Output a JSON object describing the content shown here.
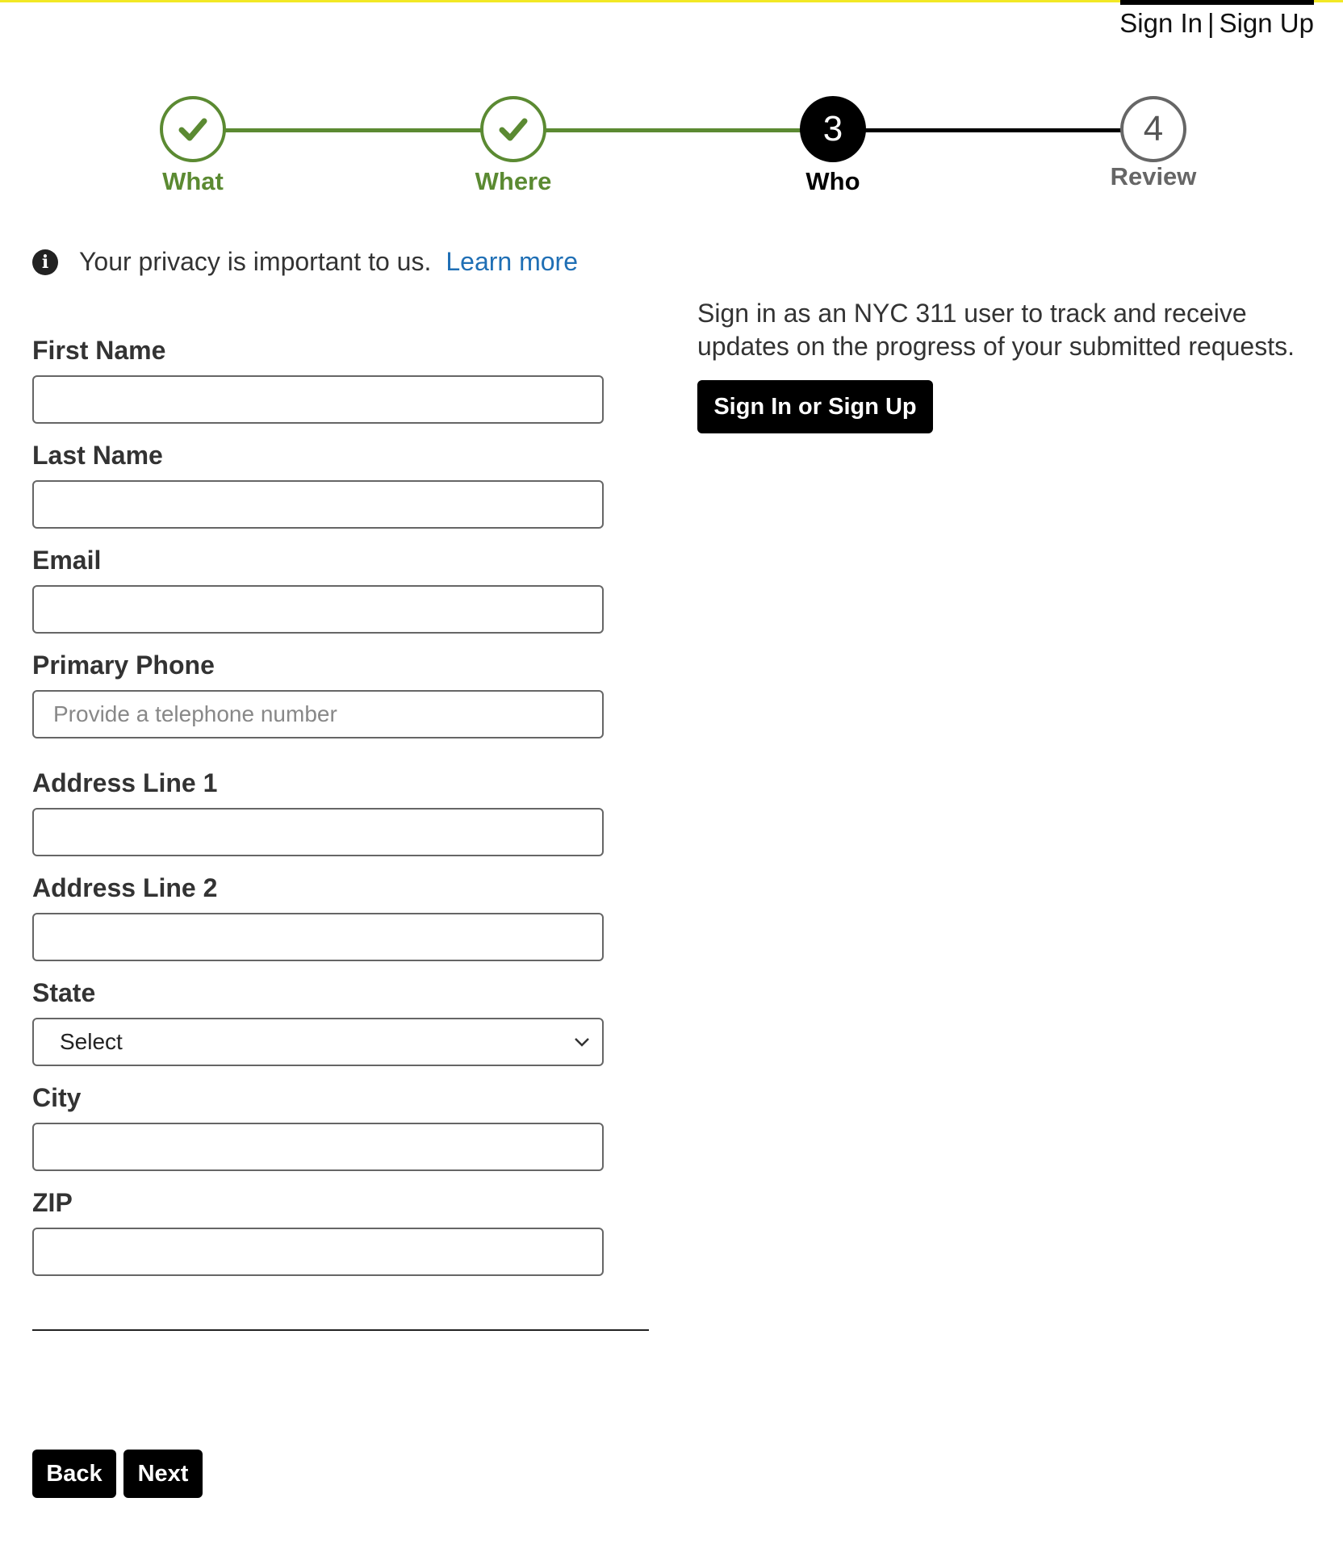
{
  "header": {
    "sign_in": "Sign In",
    "separator": "|",
    "sign_up": "Sign Up"
  },
  "stepper": {
    "steps": [
      {
        "label": "What",
        "state": "done",
        "marker": "check-icon"
      },
      {
        "label": "Where",
        "state": "done",
        "marker": "check-icon"
      },
      {
        "label": "Who",
        "state": "current",
        "number": "3"
      },
      {
        "label": "Review",
        "state": "todo",
        "number": "4"
      }
    ],
    "colors": {
      "done": "#5b8a32",
      "current": "#000000",
      "todo": "#666666"
    }
  },
  "privacy": {
    "icon": "info-icon",
    "text": "Your privacy is important to us.",
    "link": "Learn more"
  },
  "form": {
    "first_name": {
      "label": "First Name",
      "value": "",
      "placeholder": ""
    },
    "last_name": {
      "label": "Last Name",
      "value": "",
      "placeholder": ""
    },
    "email": {
      "label": "Email",
      "value": "",
      "placeholder": ""
    },
    "primary_phone": {
      "label": "Primary Phone",
      "value": "",
      "placeholder": "Provide a telephone number"
    },
    "address_line_1": {
      "label": "Address Line 1",
      "value": "",
      "placeholder": ""
    },
    "address_line_2": {
      "label": "Address Line 2",
      "value": "",
      "placeholder": ""
    },
    "state": {
      "label": "State",
      "selected": "Select"
    },
    "city": {
      "label": "City",
      "value": "",
      "placeholder": ""
    },
    "zip": {
      "label": "ZIP",
      "value": "",
      "placeholder": ""
    }
  },
  "signin_panel": {
    "text": "Sign in as an NYC 311 user to track and receive updates on the progress of your submitted requests.",
    "button": "Sign In or Sign Up"
  },
  "nav": {
    "back": "Back",
    "next": "Next"
  }
}
